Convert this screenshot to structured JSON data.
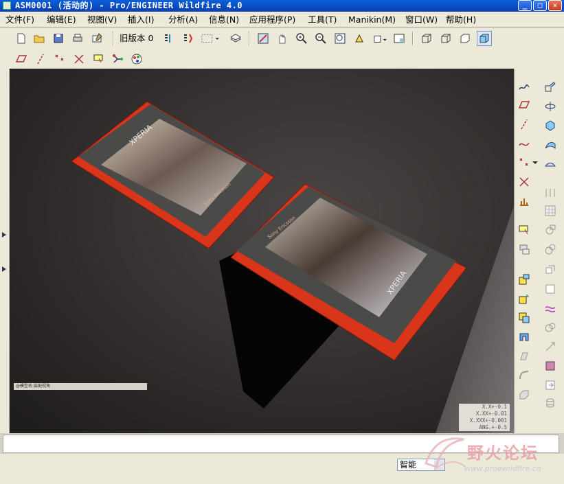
{
  "window": {
    "title": "ASM0001 (活动的) - Pro/ENGINEER Wildfire 4.0",
    "minimize": "_",
    "maximize": "□",
    "close": "✕"
  },
  "menu": [
    "文件(F)",
    "编辑(E)",
    "视图(V)",
    "插入(I)",
    "分析(A)",
    "信息(N)",
    "应用程序(P)",
    "工具(T)",
    "Manikin(M)",
    "窗口(W)",
    "帮助(H)"
  ],
  "toolbar": {
    "old_version_label": "旧版本 0"
  },
  "viewport": {
    "label_box": "@模型名:装配视角",
    "tolerance": [
      "X.X+-0.1",
      "X.XX+-0.01",
      "X.XXX+-0.001",
      "ANG.+-0.5"
    ],
    "phone_top": {
      "brand": "XPERIA",
      "maker": "Sony Ericsson"
    },
    "phone_bottom": {
      "brand": "XPERIA",
      "maker": "Sony Ericsson"
    }
  },
  "status": {
    "filter_value": "智能"
  },
  "watermark": {
    "text": "野火论坛",
    "url": "www.proewildfire.cn"
  },
  "colors": {
    "accent_red": "#e23a14",
    "phone_body": "#4a4a48"
  }
}
